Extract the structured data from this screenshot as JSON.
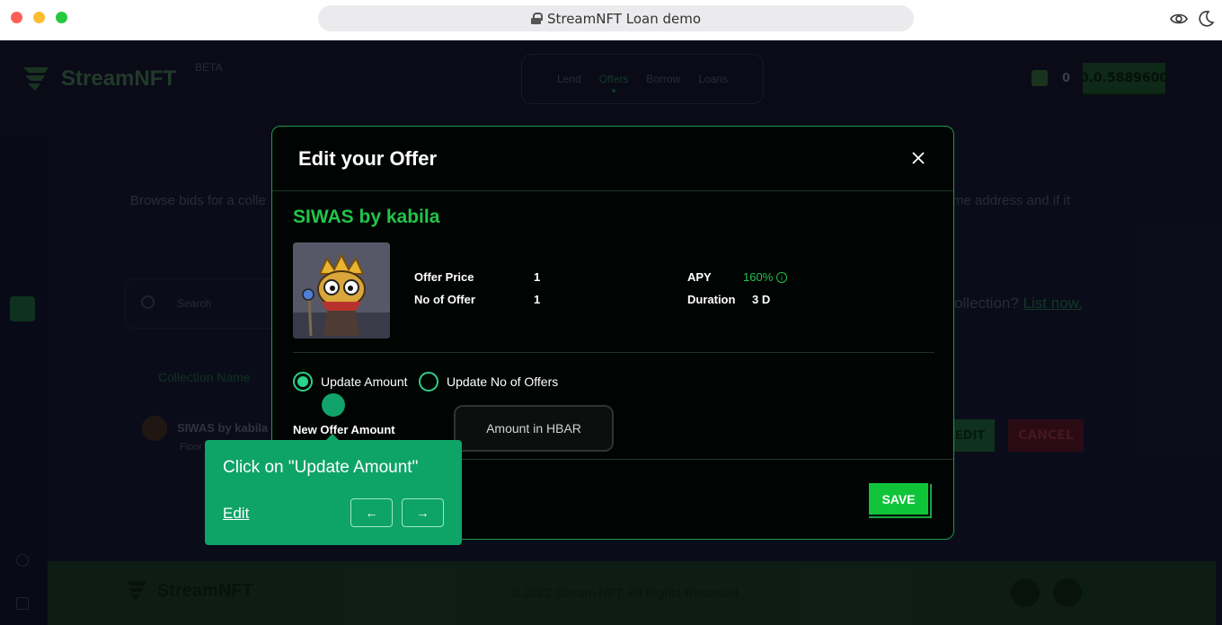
{
  "browser": {
    "url_title": "StreamNFT Loan demo"
  },
  "app": {
    "logo_text": "StreamNFT",
    "beta": "BETA",
    "nav": [
      "Lend",
      "Offers",
      "Borrow",
      "Loans"
    ],
    "active_nav": "Offers",
    "balance": "0",
    "account": "0.0.5889600",
    "intro_left": "Browse bids for a colle",
    "intro_right": "me address and if it",
    "search_placeholder": "Search",
    "list_prompt": "ollection?",
    "list_link": "List now.",
    "collection_col": "Collection Name",
    "row_name": "SIWAS by kabila",
    "row_sub": "Floor",
    "row_edit": "EDIT",
    "row_cancel": "CANCEL",
    "footer_logo": "StreamNFT",
    "copyright": "© 2022 Stream NFT. All Rights Reserved."
  },
  "modal": {
    "title": "Edit your Offer",
    "collection": "SIWAS by kabila",
    "offer_price_label": "Offer Price",
    "offer_price": "1",
    "no_of_offer_label": "No of Offer",
    "no_of_offer": "1",
    "apy_label": "APY",
    "apy": "160%",
    "duration_label": "Duration",
    "duration": "3 D",
    "radio_amount": "Update Amount",
    "radio_offers": "Update No of Offers",
    "new_amount_label": "New Offer Amount",
    "amount_placeholder": "Amount in HBAR",
    "save": "SAVE"
  },
  "tour": {
    "text": "Click on \"Update Amount\"",
    "edit": "Edit",
    "prev": "←",
    "next": "→"
  },
  "colors": {
    "accent": "#22c44a",
    "tooltip": "#0ea468",
    "save": "#10c43a"
  }
}
